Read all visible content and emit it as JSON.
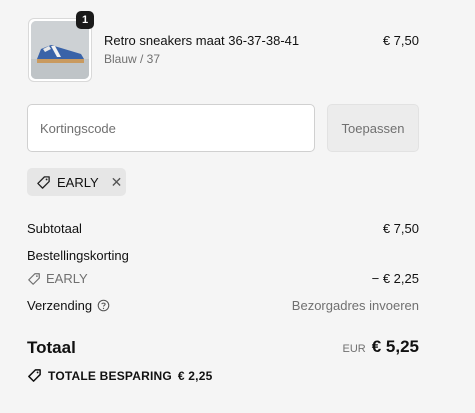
{
  "cart": {
    "item": {
      "quantity": "1",
      "name": "Retro sneakers maat 36-37-38-41",
      "variant": "Blauw / 37",
      "price": "€ 7,50",
      "image_icon": "sneaker-product-image"
    }
  },
  "discount": {
    "placeholder": "Kortingscode",
    "value": "",
    "apply_label": "Toepassen",
    "applied_code": "EARLY"
  },
  "summary": {
    "subtotal_label": "Subtotaal",
    "subtotal_value": "€ 7,50",
    "discount_label": "Bestellingskorting",
    "discount_code": "EARLY",
    "discount_value": "− € 2,25",
    "shipping_label": "Verzending",
    "shipping_value": "Bezorgadres invoeren",
    "total_label": "Totaal",
    "currency": "EUR",
    "total_value": "€ 5,25",
    "savings_label": "TOTALE BESPARING",
    "savings_value": "€ 2,25"
  },
  "colors": {
    "background": "#f5f5f5",
    "muted_text": "#707070",
    "badge": "#1a1a1a",
    "chip": "#e6e6e6"
  }
}
